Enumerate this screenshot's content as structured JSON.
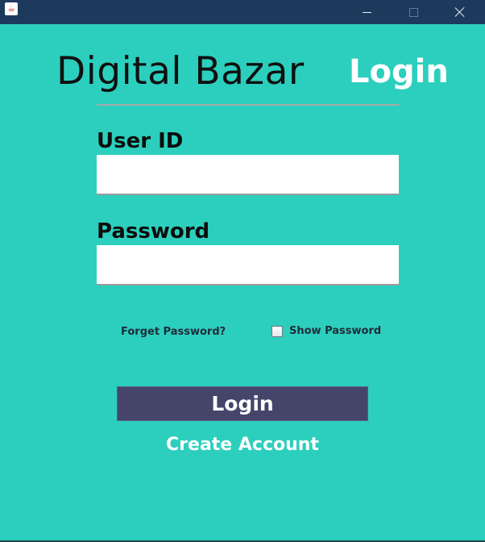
{
  "window": {
    "title": "",
    "controls": {
      "minimize": "minimize-icon",
      "maximize": "maximize-icon",
      "close": "close-icon"
    }
  },
  "brand": {
    "name": "Digital Bazar"
  },
  "header": {
    "title": "Login"
  },
  "form": {
    "user_id_label": "User ID",
    "user_id_value": "",
    "password_label": "Password",
    "password_value": "",
    "forget_password": "Forget Password?",
    "show_password_label": "Show Password",
    "show_password_checked": false,
    "login_button": "Login",
    "create_account": "Create Account"
  },
  "colors": {
    "background": "#2ccfbd",
    "titlebar": "#1c3a5c",
    "login_button": "#45456a",
    "title_text": "#ffffff"
  }
}
